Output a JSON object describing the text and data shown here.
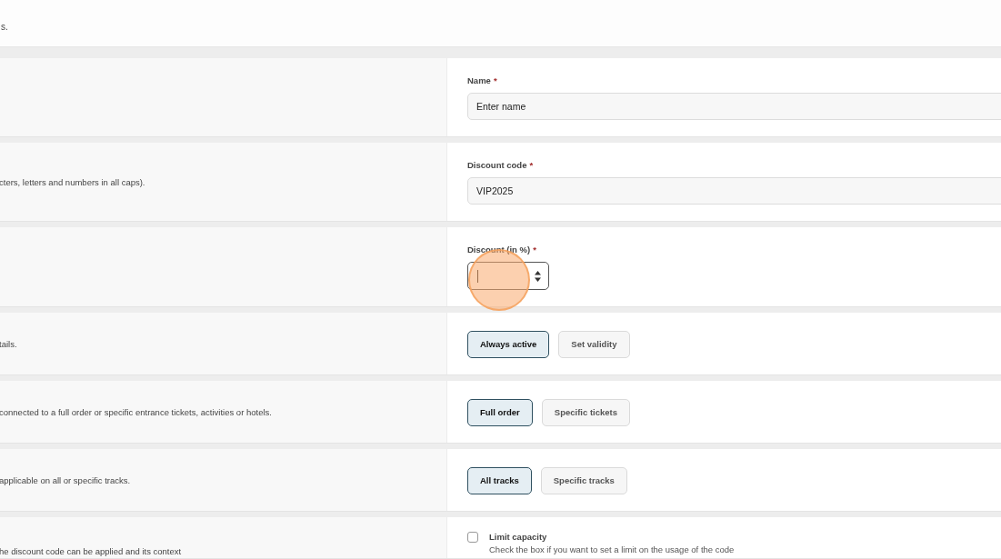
{
  "header": {
    "text": "s."
  },
  "sections": [
    {
      "kind": "text_field",
      "label": "Name",
      "required_mark": "*",
      "placeholder": "Enter name"
    },
    {
      "kind": "text_field",
      "description": "cters, letters and numbers in all caps).",
      "label": "Discount code",
      "required_mark": "*",
      "value": "VIP2025"
    },
    {
      "kind": "number_field",
      "label": "Discount (in %)",
      "required_mark": "*",
      "focused": true
    },
    {
      "kind": "toggle",
      "description": "tails.",
      "options": [
        {
          "label": "Always active",
          "selected": true
        },
        {
          "label": "Set validity",
          "selected": false
        }
      ]
    },
    {
      "kind": "toggle",
      "description": "connected to a full order or specific entrance tickets, activities or hotels.",
      "options": [
        {
          "label": "Full order",
          "selected": true
        },
        {
          "label": "Specific tickets",
          "selected": false
        }
      ]
    },
    {
      "kind": "toggle",
      "description": "applicable on all or specific tracks.",
      "options": [
        {
          "label": "All tracks",
          "selected": true
        },
        {
          "label": "Specific tracks",
          "selected": false
        }
      ]
    },
    {
      "kind": "checkbox",
      "description": "he discount code can be applied and its context",
      "label": "Limit capacity",
      "checked": false,
      "hint": "Check the box if you want to set a limit on the usage of the code"
    }
  ]
}
